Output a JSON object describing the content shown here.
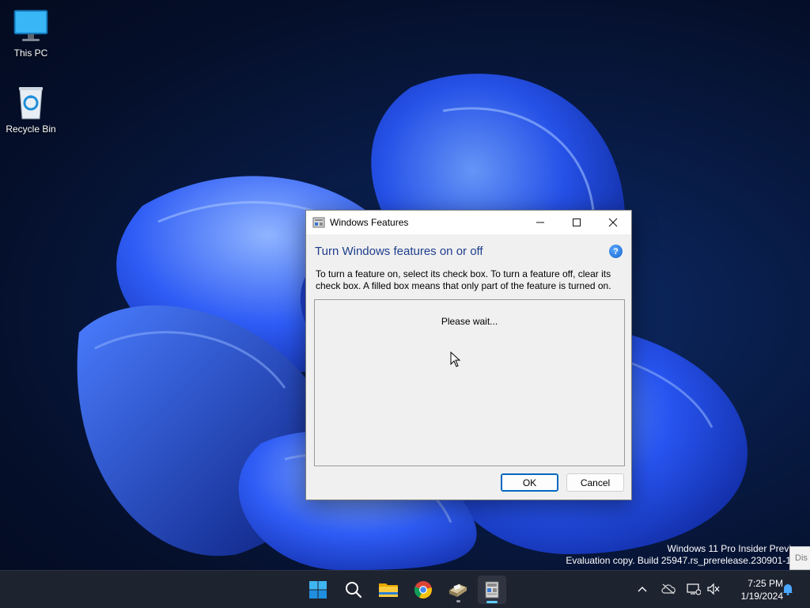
{
  "desktop": {
    "icons": [
      {
        "label": "This PC",
        "icon": "monitor-icon"
      },
      {
        "label": "Recycle Bin",
        "icon": "recycle-bin-icon"
      }
    ]
  },
  "dialog": {
    "title": "Windows Features",
    "heading": "Turn Windows features on or off",
    "description": "To turn a feature on, select its check box. To turn a feature off, clear its check box. A filled box means that only part of the feature is turned on.",
    "status": "Please wait...",
    "help_glyph": "?",
    "buttons": {
      "ok": "OK",
      "cancel": "Cancel"
    },
    "caption_buttons": [
      "minimize",
      "maximize",
      "close"
    ]
  },
  "watermark": {
    "line1": "Windows 11 Pro Insider Previ",
    "line2": "Evaluation copy. Build 25947.rs_prerelease.230901-1",
    "side_tab": "Dis"
  },
  "taskbar": {
    "apps": [
      "start-icon",
      "search-icon",
      "file-explorer-icon",
      "chrome-icon",
      "scanner-app-icon",
      "windows-features-icon"
    ],
    "tray_icons": [
      "chevron-up-icon",
      "cloud-offline-icon",
      "network-icon",
      "volume-muted-icon",
      "notification-bell-icon"
    ],
    "time": "7:25 PM",
    "date": "1/19/2024"
  },
  "colors": {
    "accent": "#0067c0",
    "heading": "#1e3e8c",
    "taskbar": "#1e2330",
    "active_indicator": "#60cdff"
  }
}
